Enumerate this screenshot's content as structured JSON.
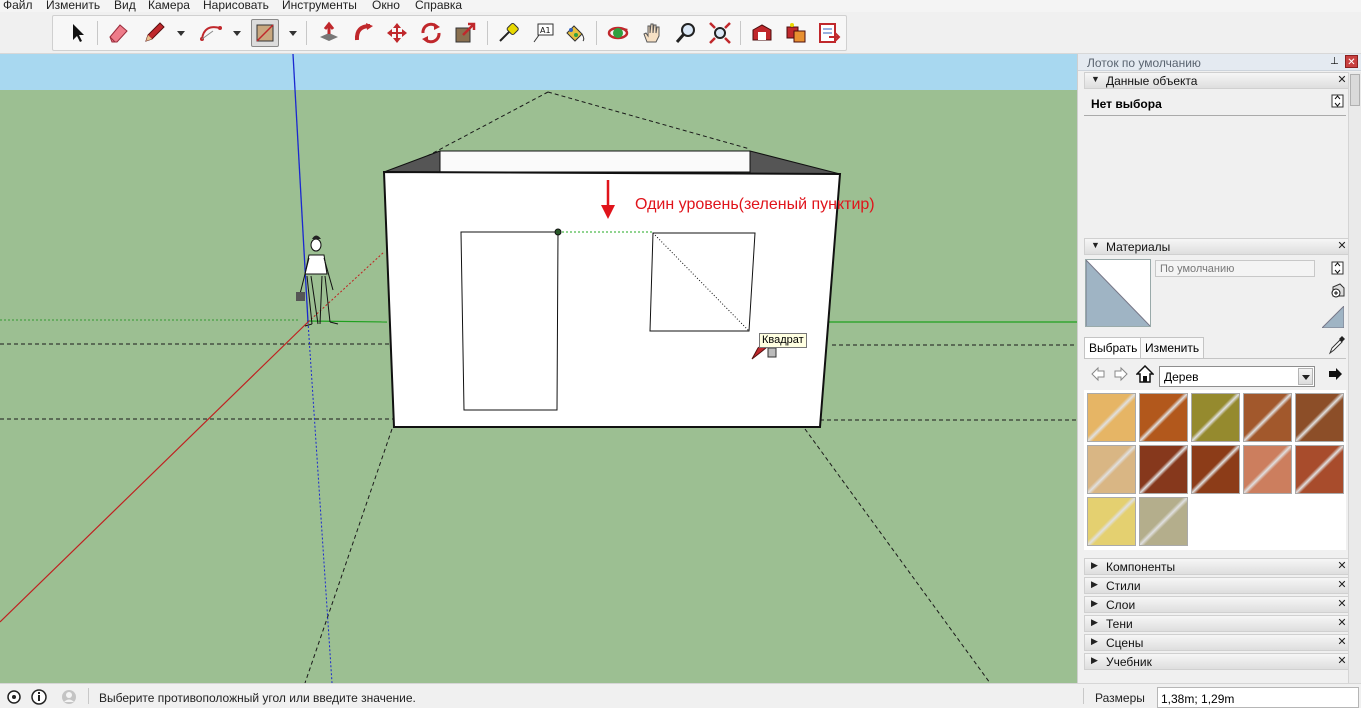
{
  "menu": [
    "Файл",
    "Изменить",
    "Вид",
    "Камера",
    "Нарисовать",
    "Инструменты",
    "Окно",
    "Справка"
  ],
  "toolbar_icons": [
    "select-icon",
    "eraser-icon",
    "pencil-icon",
    "arc-icon",
    "rectangle-icon",
    "push-pull-icon",
    "follow-me-icon",
    "move-icon",
    "rotate-icon",
    "scale-icon",
    "tape-measure-icon",
    "text-icon",
    "paint-bucket-icon",
    "orbit-icon",
    "pan-icon",
    "zoom-icon",
    "zoom-extents-icon",
    "warehouse-icon",
    "extension-icon",
    "send-to-layout-icon"
  ],
  "viewport": {
    "annotation": "Один уровень(зеленый пунктир)",
    "tooltip": "Квадрат",
    "colors": {
      "sky": "#a8d8f0",
      "ground": "#9cbf92",
      "wall": "#ffffff",
      "annotation": "#e0141b"
    }
  },
  "tray": {
    "title": "Лоток по умолчанию",
    "entity_panel": {
      "label": "Данные объекта",
      "selection": "Нет выбора"
    },
    "materials_panel": {
      "label": "Материалы",
      "material_name": "По умолчанию",
      "tabs": [
        "Выбрать",
        "Изменить"
      ],
      "library": "Дерев",
      "swatches": [
        "#e6b565",
        "#b2581c",
        "#958a2e",
        "#a2582c",
        "#8c4e28",
        "#d9b684",
        "#86381c",
        "#8c3c18",
        "#cc7e5e",
        "#a84c2c",
        "#e4d070",
        "#b4ae8c"
      ]
    },
    "collapsed_panels": [
      "Компоненты",
      "Стили",
      "Слои",
      "Тени",
      "Сцены",
      "Учебник"
    ]
  },
  "status": {
    "message": "Выберите противоположный угол или введите значение.",
    "dimension_label": "Размеры",
    "dimension_value": "1,38m; 1,29m"
  }
}
